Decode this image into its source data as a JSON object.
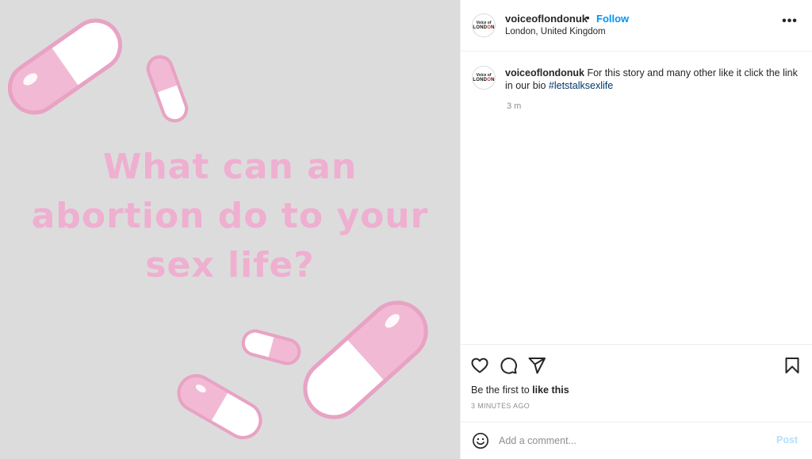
{
  "post": {
    "image_text_lines": [
      "What can an",
      "abortion do to your",
      "sex life?"
    ],
    "colors": {
      "background": "#dcdcdc",
      "text": "#efafd0",
      "pill_pink": "#f2b9d4",
      "pill_outline": "#e8a3c4"
    }
  },
  "header": {
    "avatar_top": "Voice of",
    "avatar_bottom_a": "LOND",
    "avatar_bottom_b": "O",
    "avatar_bottom_c": "N",
    "username": "voiceoflondonuk",
    "dot": "•",
    "follow": "Follow",
    "location": "London, United Kingdom",
    "more": "•••"
  },
  "caption": {
    "username": "voiceoflondonuk",
    "text": " For this story and many other like it click the link in our bio ",
    "hashtag": "#letstalksexlife",
    "time": "3 m"
  },
  "actions": {
    "icons": [
      "heart-icon",
      "comment-icon",
      "share-icon",
      "bookmark-icon"
    ],
    "likes_prefix": "Be the first to ",
    "likes_bold": "like this",
    "time_ago": "3 MINUTES AGO"
  },
  "comment": {
    "placeholder": "Add a comment...",
    "post_label": "Post"
  }
}
